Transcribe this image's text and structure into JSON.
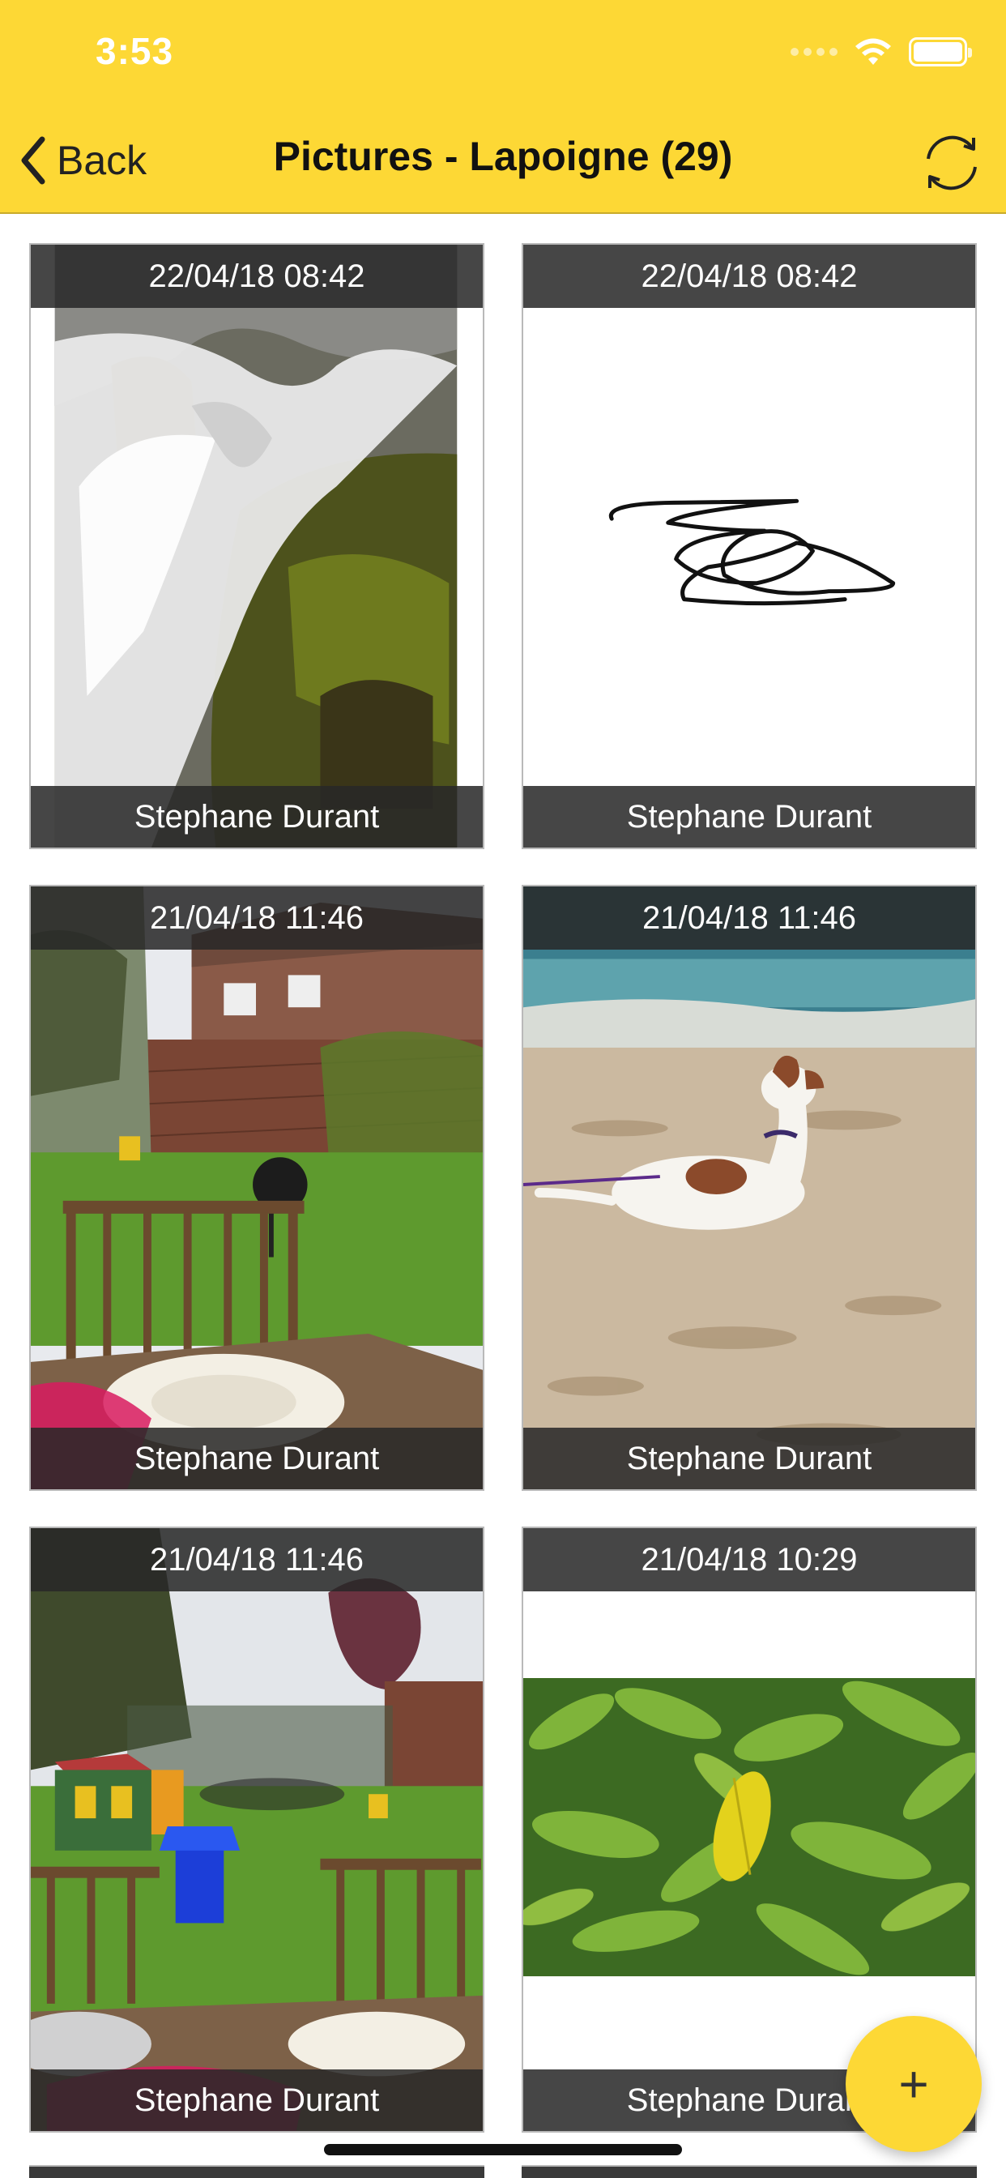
{
  "status_bar": {
    "time": "3:53"
  },
  "nav": {
    "back_label": "Back",
    "title": "Pictures - Lapoigne (29)"
  },
  "pictures": [
    {
      "date": "22/04/18 08:42",
      "author": "Stephane Durant",
      "subject": "waterfall"
    },
    {
      "date": "22/04/18 08:42",
      "author": "Stephane Durant",
      "subject": "signature"
    },
    {
      "date": "21/04/18 11:46",
      "author": "Stephane Durant",
      "subject": "garden-wall"
    },
    {
      "date": "21/04/18 11:46",
      "author": "Stephane Durant",
      "subject": "dog-on-beach"
    },
    {
      "date": "21/04/18 11:46",
      "author": "Stephane Durant",
      "subject": "garden-playhouse"
    },
    {
      "date": "21/04/18 10:29",
      "author": "Stephane Durant",
      "subject": "lemon-leaves"
    }
  ],
  "fab": {
    "icon": "plus-icon",
    "label": "+"
  },
  "colors": {
    "accent": "#FDD835",
    "overlay": "#282828"
  }
}
